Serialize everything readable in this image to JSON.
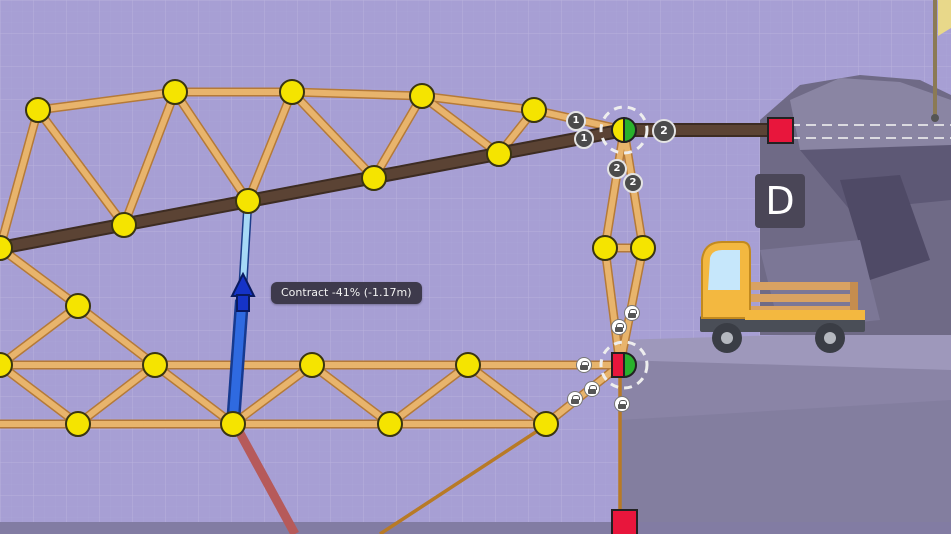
{
  "hud": {
    "tooltip_text": "Contract -41% (-1.17m)",
    "checkpoint_label": "D",
    "split_joint_badges": [
      "1",
      "1",
      "2",
      "2",
      "2"
    ]
  },
  "colors": {
    "background": "#a79fd4",
    "grid_line": "#b8b2dd",
    "wood": "#e8b46c",
    "wood_outline": "#b57a38",
    "road": "#5b4334",
    "joint": "#f5e400",
    "anchor": "#e8163c",
    "hydraulic": "#2f5fd0",
    "hydraulic_piston": "#a6d8f6",
    "rope": "#b87a26",
    "spring": "#b65a5a",
    "truck_body": "#f3b840",
    "terrain": "#6f6a86"
  },
  "icons": [
    "lock-icon",
    "split-joint-icon",
    "anchor-icon",
    "arrow-up-icon",
    "flag-icon"
  ]
}
